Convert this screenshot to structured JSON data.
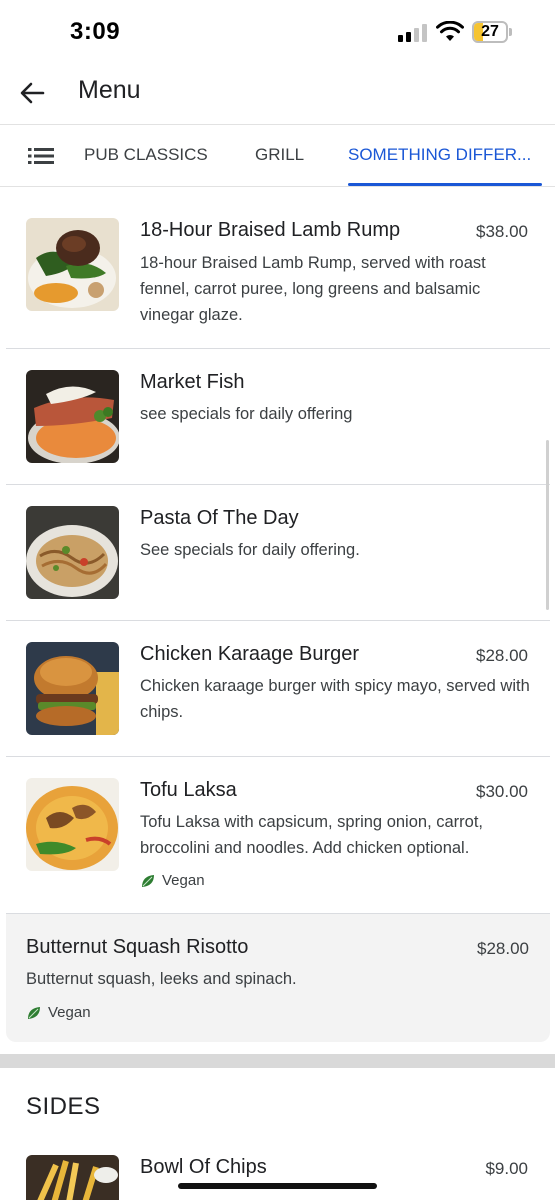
{
  "status_bar": {
    "time": "3:09",
    "battery": "27",
    "battery_level": 0.27
  },
  "header": {
    "title": "Menu"
  },
  "tabs": [
    {
      "label": "PUB CLASSICS"
    },
    {
      "label": "GRILL"
    },
    {
      "label": "SOMETHING DIFFER..."
    }
  ],
  "active_tab": 2,
  "items": [
    {
      "name": "18-Hour Braised Lamb Rump",
      "price": "$38.00",
      "description": "18-hour Braised Lamb Rump, served with roast fennel, carrot puree, long greens and balsamic vinegar glaze."
    },
    {
      "name": "Market Fish",
      "price": "",
      "description": "see specials for daily offering"
    },
    {
      "name": "Pasta Of The Day",
      "price": "",
      "description": "See specials for daily offering."
    },
    {
      "name": "Chicken Karaage Burger",
      "price": "$28.00",
      "description": "Chicken karaage burger with spicy mayo, served with chips."
    },
    {
      "name": "Tofu Laksa",
      "price": "$30.00",
      "description": "Tofu Laksa with capsicum, spring onion, carrot, broccolini and noodles. Add chicken optional.",
      "tag": "Vegan"
    },
    {
      "name": "Butternut Squash Risotto",
      "price": "$28.00",
      "description": "Butternut squash, leeks and spinach.",
      "tag": "Vegan"
    }
  ],
  "sides": {
    "title": "SIDES",
    "items": [
      {
        "name": "Bowl Of Chips",
        "price": "$9.00"
      }
    ]
  },
  "colors": {
    "accent": "#1a57d6",
    "vegan_leaf": "#2e7d32",
    "battery": "#f6c431"
  }
}
